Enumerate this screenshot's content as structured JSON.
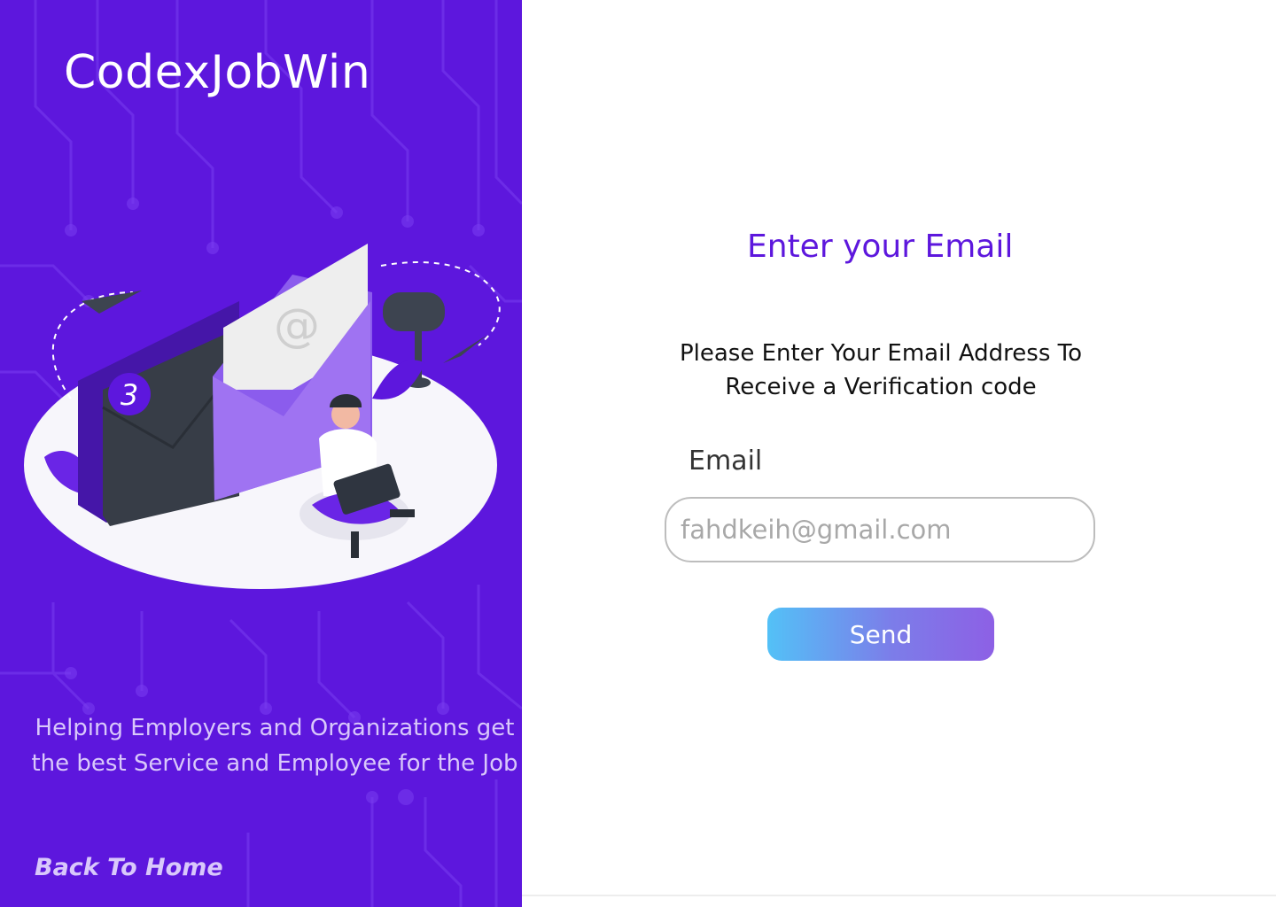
{
  "brand": {
    "name": "CodexJobWin"
  },
  "left": {
    "tagline": "Helping Employers and Organizations get the best Service and Employee for the Job",
    "back_link": "Back To Home",
    "illustration": {
      "badge_number": "3",
      "at_symbol": "@"
    }
  },
  "form": {
    "title": "Enter your Email",
    "instructions": "Please Enter Your Email Address To Receive a Verification code",
    "email_label": "Email",
    "email_placeholder": "fahdkeih@gmail.com",
    "email_value": "",
    "send_label": "Send"
  },
  "colors": {
    "primary": "#5d17dd",
    "gradient_start": "#53c1f7",
    "gradient_end": "#8d60e5",
    "tagline_text": "#d9c8fb"
  }
}
